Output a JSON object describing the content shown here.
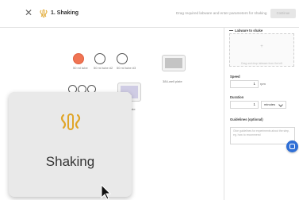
{
  "header": {
    "title": "1. Shaking",
    "hint": "Drag required labware and enter parameters for shaking",
    "continue_label": "Continue"
  },
  "canvas": {
    "labels": {
      "tube_1": "50 ml tube",
      "tube_2": "50 ml tube #2",
      "tube_3": "50 ml tube #3",
      "plate_384": "384-well plate"
    },
    "partial_label": "ate"
  },
  "panel": {
    "labware_heading": "Labware to shake",
    "drop_hint": "Drag and drop labware from the left",
    "speed_label": "Speed",
    "speed_value": "1",
    "speed_unit": "rpm",
    "duration_label": "Duration",
    "duration_value": "1",
    "duration_unit": "minutes",
    "guidelines_label": "Guidelines (optional)",
    "guidelines_placeholder": "Give guidelines for experiments about the step, eg. how to recommend"
  },
  "tooltip": {
    "label": "Shaking"
  },
  "colors": {
    "accent_orange": "#f07453",
    "chat_blue": "#2f6fd6",
    "icon_gold": "#e0a528"
  }
}
